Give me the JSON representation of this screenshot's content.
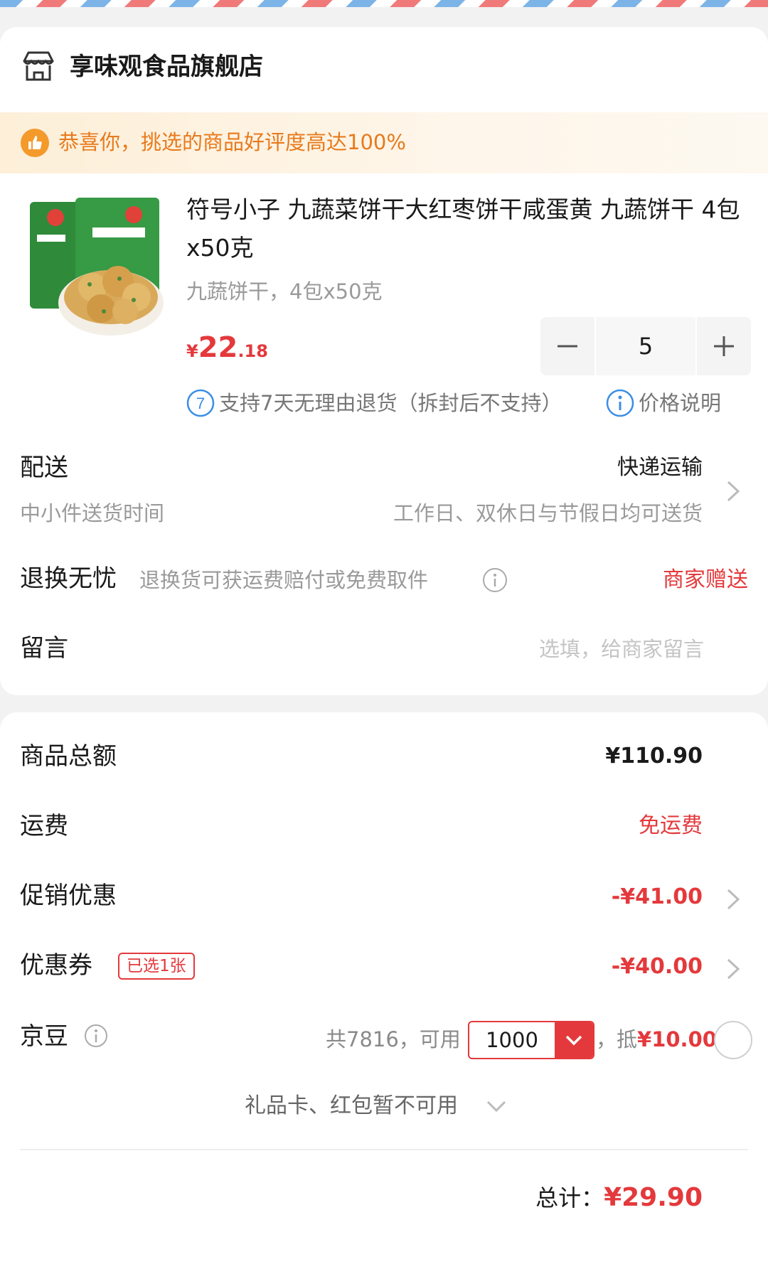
{
  "store": {
    "name": "享味观食品旗舰店",
    "icon": "store-icon"
  },
  "banner": {
    "icon": "thumbs-up-icon",
    "text": "恭喜你，挑选的商品好评度高达100%"
  },
  "product": {
    "title": "符号小子 九蔬菜饼干大红枣饼干咸蛋黄 九蔬饼干 4包x50克",
    "spec": "九蔬饼干，4包x50克",
    "price_currency": "¥",
    "price_int": "22",
    "price_dec": ".18",
    "quantity": "5",
    "return_policy": "支持7天无理由退货（拆封后不支持）",
    "return_badge": "7",
    "price_note": "价格说明"
  },
  "delivery": {
    "label": "配送",
    "method": "快递运输",
    "sub_label": "中小件送货时间",
    "note": "工作日、双休日与节假日均可送货"
  },
  "worry_free": {
    "label": "退换无忧",
    "desc": "退换货可获运费赔付或免费取件",
    "gift": "商家赠送"
  },
  "message": {
    "label": "留言",
    "placeholder": "选填，给商家留言"
  },
  "summary": {
    "goods_total_label": "商品总额",
    "goods_total": "¥110.90",
    "shipping_label": "运费",
    "shipping": "免运费",
    "promo_label": "促销优惠",
    "promo": "-¥41.00",
    "coupon_label": "优惠券",
    "coupon_badge": "已选1张",
    "coupon": "-¥40.00",
    "beans_label": "京豆",
    "beans_total": "共7816，可用",
    "beans_selected": "1000",
    "beans_deduct_prefix": "，抵",
    "beans_deduct": "¥10.00",
    "giftcard_text": "礼品卡、红包暂不可用",
    "total_label": "总计：",
    "total": "¥29.90"
  },
  "colors": {
    "accent_red": "#e4393c",
    "banner_orange": "#e87a1c",
    "info_blue": "#3a8ee6"
  }
}
